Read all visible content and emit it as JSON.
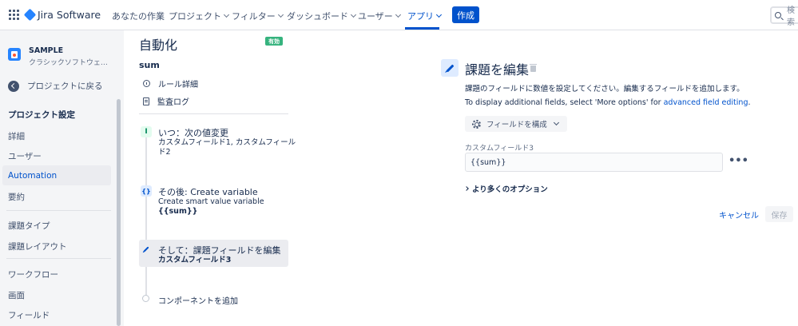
{
  "topnav": {
    "brand": "Jira Software",
    "items": [
      {
        "label": "あなたの作業",
        "has_chevron": false
      },
      {
        "label": "プロジェクト",
        "has_chevron": true
      },
      {
        "label": "フィルター",
        "has_chevron": true
      },
      {
        "label": "ダッシュボード",
        "has_chevron": true
      },
      {
        "label": "ユーザー",
        "has_chevron": true
      },
      {
        "label": "アプリ",
        "has_chevron": true,
        "active": true
      }
    ],
    "create_label": "作成",
    "search_placeholder": "検索"
  },
  "sidebar": {
    "project_name": "SAMPLE",
    "project_type": "クラシックソフトウェアプ...",
    "back_label": "プロジェクトに戻る",
    "section_heading": "プロジェクト設定",
    "items": [
      {
        "label": "詳細"
      },
      {
        "label": "ユーザー"
      },
      {
        "label": "Automation",
        "selected": true
      },
      {
        "label": "要約"
      },
      {
        "label": "課題タイプ"
      },
      {
        "label": "課題レイアウト"
      },
      {
        "label": "ワークフロー"
      },
      {
        "label": "画面"
      },
      {
        "label": "フィールド"
      }
    ]
  },
  "rule": {
    "page_title": "自動化",
    "status_badge": "有効",
    "name": "sum",
    "links": {
      "details": "ルール詳細",
      "audit_log": "監査ログ"
    },
    "components": {
      "trigger": {
        "title": "いつ：次の値変更",
        "sub_line1": "カスタムフィールド1, カスタムフィール",
        "sub_line2": "ド2"
      },
      "variable": {
        "title": "その後: Create variable",
        "sub_line1": "Create smart value variable",
        "sub_line2": "{{sum}}"
      },
      "edit": {
        "title": "そして：課題フィールドを編集",
        "sub_line1": "カスタムフィールド3"
      }
    },
    "add_component": "コンポーネントを追加"
  },
  "config": {
    "title": "課題を編集",
    "desc": "課題のフィールドに数値を設定してください。編集するフィールドを追加します。",
    "desc2_prefix": "To display additional fields, select 'More options' for ",
    "desc2_link": "advanced field editing",
    "desc2_suffix": ".",
    "configure_label": "フィールドを構成",
    "field_label": "カスタムフィールド3",
    "field_value": "{{sum}}",
    "more_options": "より多くのオプション",
    "cancel": "キャンセル",
    "save": "保存"
  },
  "colors": {
    "accent": "#0052CC",
    "badge": "#36B37E",
    "sidebar_bg": "#F4F5F7"
  }
}
